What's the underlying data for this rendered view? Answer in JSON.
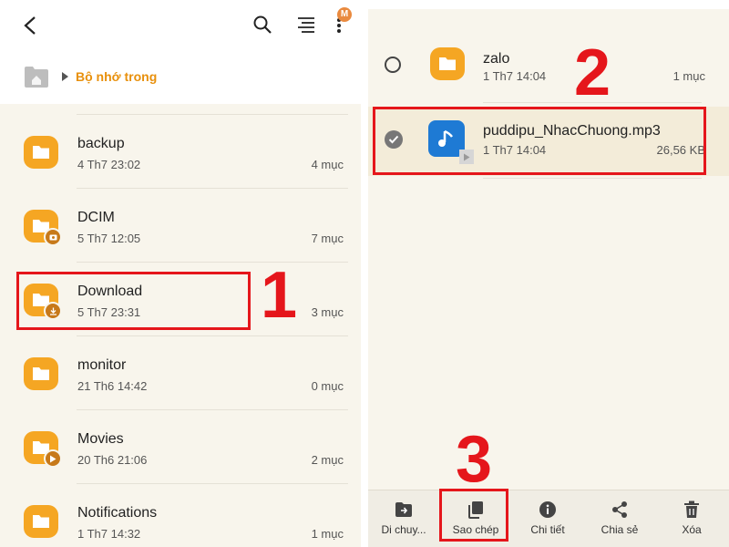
{
  "left": {
    "breadcrumb": {
      "label": "Bộ nhớ trong"
    },
    "badge": "M",
    "folders": [
      {
        "name": "backup",
        "date": "4 Th7 23:02",
        "count": "4 mục"
      },
      {
        "name": "DCIM",
        "date": "5 Th7 12:05",
        "count": "7 mục"
      },
      {
        "name": "Download",
        "date": "5 Th7 23:31",
        "count": "3 mục"
      },
      {
        "name": "monitor",
        "date": "21 Th6 14:42",
        "count": "0 mục"
      },
      {
        "name": "Movies",
        "date": "20 Th6 21:06",
        "count": "2 mục"
      },
      {
        "name": "Notifications",
        "date": "1 Th7 14:32",
        "count": "1 mục"
      }
    ]
  },
  "right": {
    "items": [
      {
        "name": "zalo",
        "date": "1 Th7 14:04",
        "count": "1 mục"
      },
      {
        "name": "puddipu_NhacChuong.mp3",
        "date": "1 Th7 14:04",
        "count": "26,56 KB"
      }
    ],
    "toolbar": [
      {
        "label": "Di chuy...",
        "icon": "move-icon"
      },
      {
        "label": "Sao chép",
        "icon": "copy-icon"
      },
      {
        "label": "Chi tiết",
        "icon": "info-icon"
      },
      {
        "label": "Chia sẻ",
        "icon": "share-icon"
      },
      {
        "label": "Xóa",
        "icon": "trash-icon"
      }
    ]
  },
  "annotations": {
    "step1": "1",
    "step2": "2",
    "step3": "3"
  },
  "colors": {
    "folder": "#f5a623",
    "accent": "#e8900c",
    "highlight": "#e5161b",
    "music": "#1e7ad4"
  }
}
